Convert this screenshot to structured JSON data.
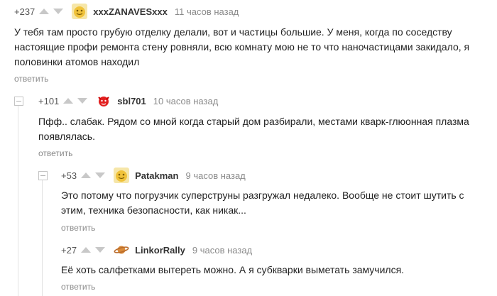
{
  "comments": [
    {
      "rating": "+237",
      "username": "xxxZANAVESxxx",
      "time": "11 часов назад",
      "avatar": "gold-smiley-avatar",
      "lines": [
        "У тебя там просто грубую отделку делали, вот и частицы большие. У меня, когда по соседству",
        "настоящие профи ремонта стену ровняли, всю комнату мою не то что наночастицами закидало, я",
        "половинки атомов находил"
      ],
      "reply": "ответить"
    },
    {
      "rating": "+101",
      "username": "sbl701",
      "time": "10 часов назад",
      "avatar": "red-devil-avatar",
      "lines": [
        "Пфф.. слабак. Рядом со мной когда старый дом разбирали, местами кварк-глюонная плазма",
        "появлялась."
      ],
      "reply": "ответить"
    },
    {
      "rating": "+53",
      "username": "Patakman",
      "time": "9 часов назад",
      "avatar": "gold-smiley-avatar",
      "lines": [
        "Это потому что погрузчик суперструны разгружал недалеко. Вообще не стоит шутить с",
        "этим, техника безопасности, как никак..."
      ],
      "reply": "ответить"
    },
    {
      "rating": "+27",
      "username": "LinkorRally",
      "time": "9 часов назад",
      "avatar": "saturn-avatar",
      "lines": [
        "Её хоть салфетками вытереть можно. А я субкварки выметать замучился."
      ],
      "reply": "ответить"
    }
  ],
  "colors": {
    "arrow": "#c8c8c8",
    "meta": "#8a8a8a",
    "username": "#333333",
    "text": "#222222"
  }
}
